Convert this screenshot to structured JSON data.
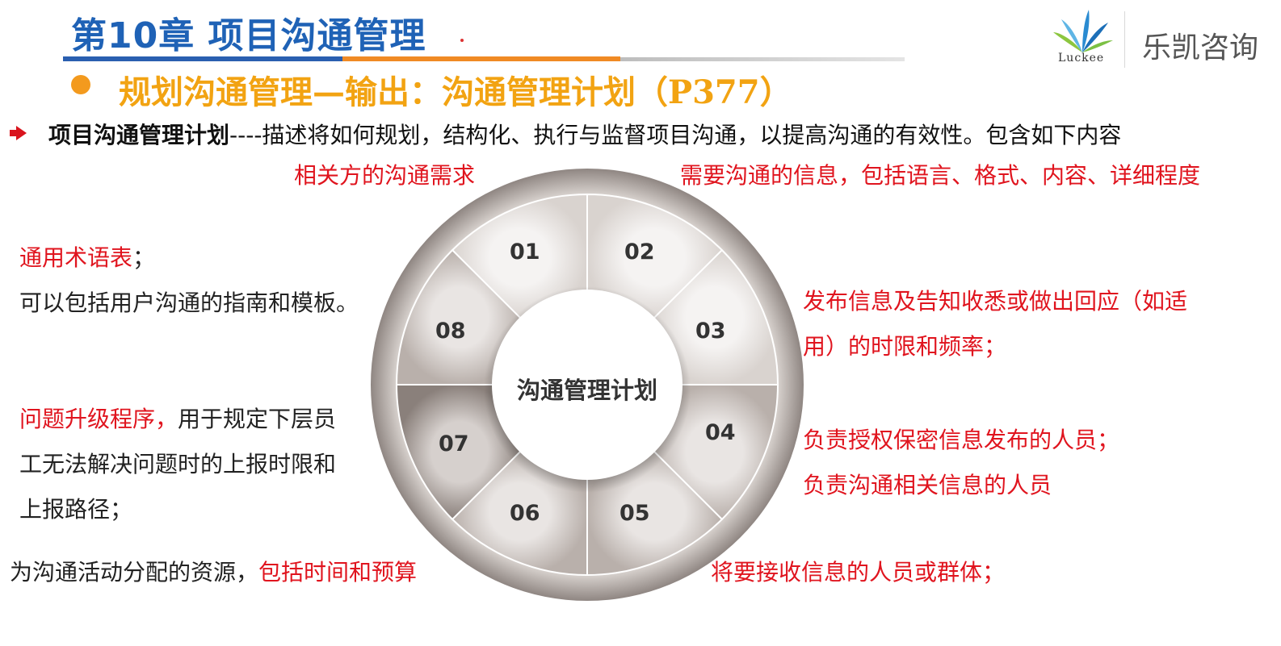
{
  "header": {
    "chapter_title": "第10章 项目沟通管理",
    "logo_cn": "乐凯咨询",
    "logo_en": "Luckee",
    "colors": {
      "title_blue": "#1f62b6",
      "orange": "#f39a1e",
      "red": "#e0141e"
    }
  },
  "section": {
    "title": "规划沟通管理—输出：沟通管理计划（P377）"
  },
  "main_line": {
    "bold": "项目沟通管理计划",
    "rest": "----描述将如何规划，结构化、执行与监督项目沟通，以提高沟通的有效性。包含如下内容"
  },
  "wheel": {
    "center_label": "沟通管理计划",
    "segments": [
      "01",
      "02",
      "03",
      "04",
      "05",
      "06",
      "07",
      "08"
    ]
  },
  "annotations": {
    "s01": "相关方的沟通需求",
    "s02": "需要沟通的信息，包括语言、格式、内容、详细程度",
    "s03_line1": "发布信息及告知收悉或做出回应（如适",
    "s03_line2": "用）的时限和频率；",
    "s04_line1": "负责授权保密信息发布的人员；",
    "s04_line2": "负责沟通相关信息的人员",
    "s05": "将要接收信息的人员或群体；",
    "s06_black": "为沟通活动分配的资源，",
    "s06_red": "包括时间和预算",
    "s07_red": "问题升级程序，",
    "s07_line1_black": "用于规定下层员",
    "s07_line2": "工无法解决问题时的上报时限和",
    "s07_line3": "上报路径；",
    "s08_red": "通用术语表",
    "s08_sep": "；",
    "s08_line2": "可以包括用户沟通的指南和模板。"
  }
}
